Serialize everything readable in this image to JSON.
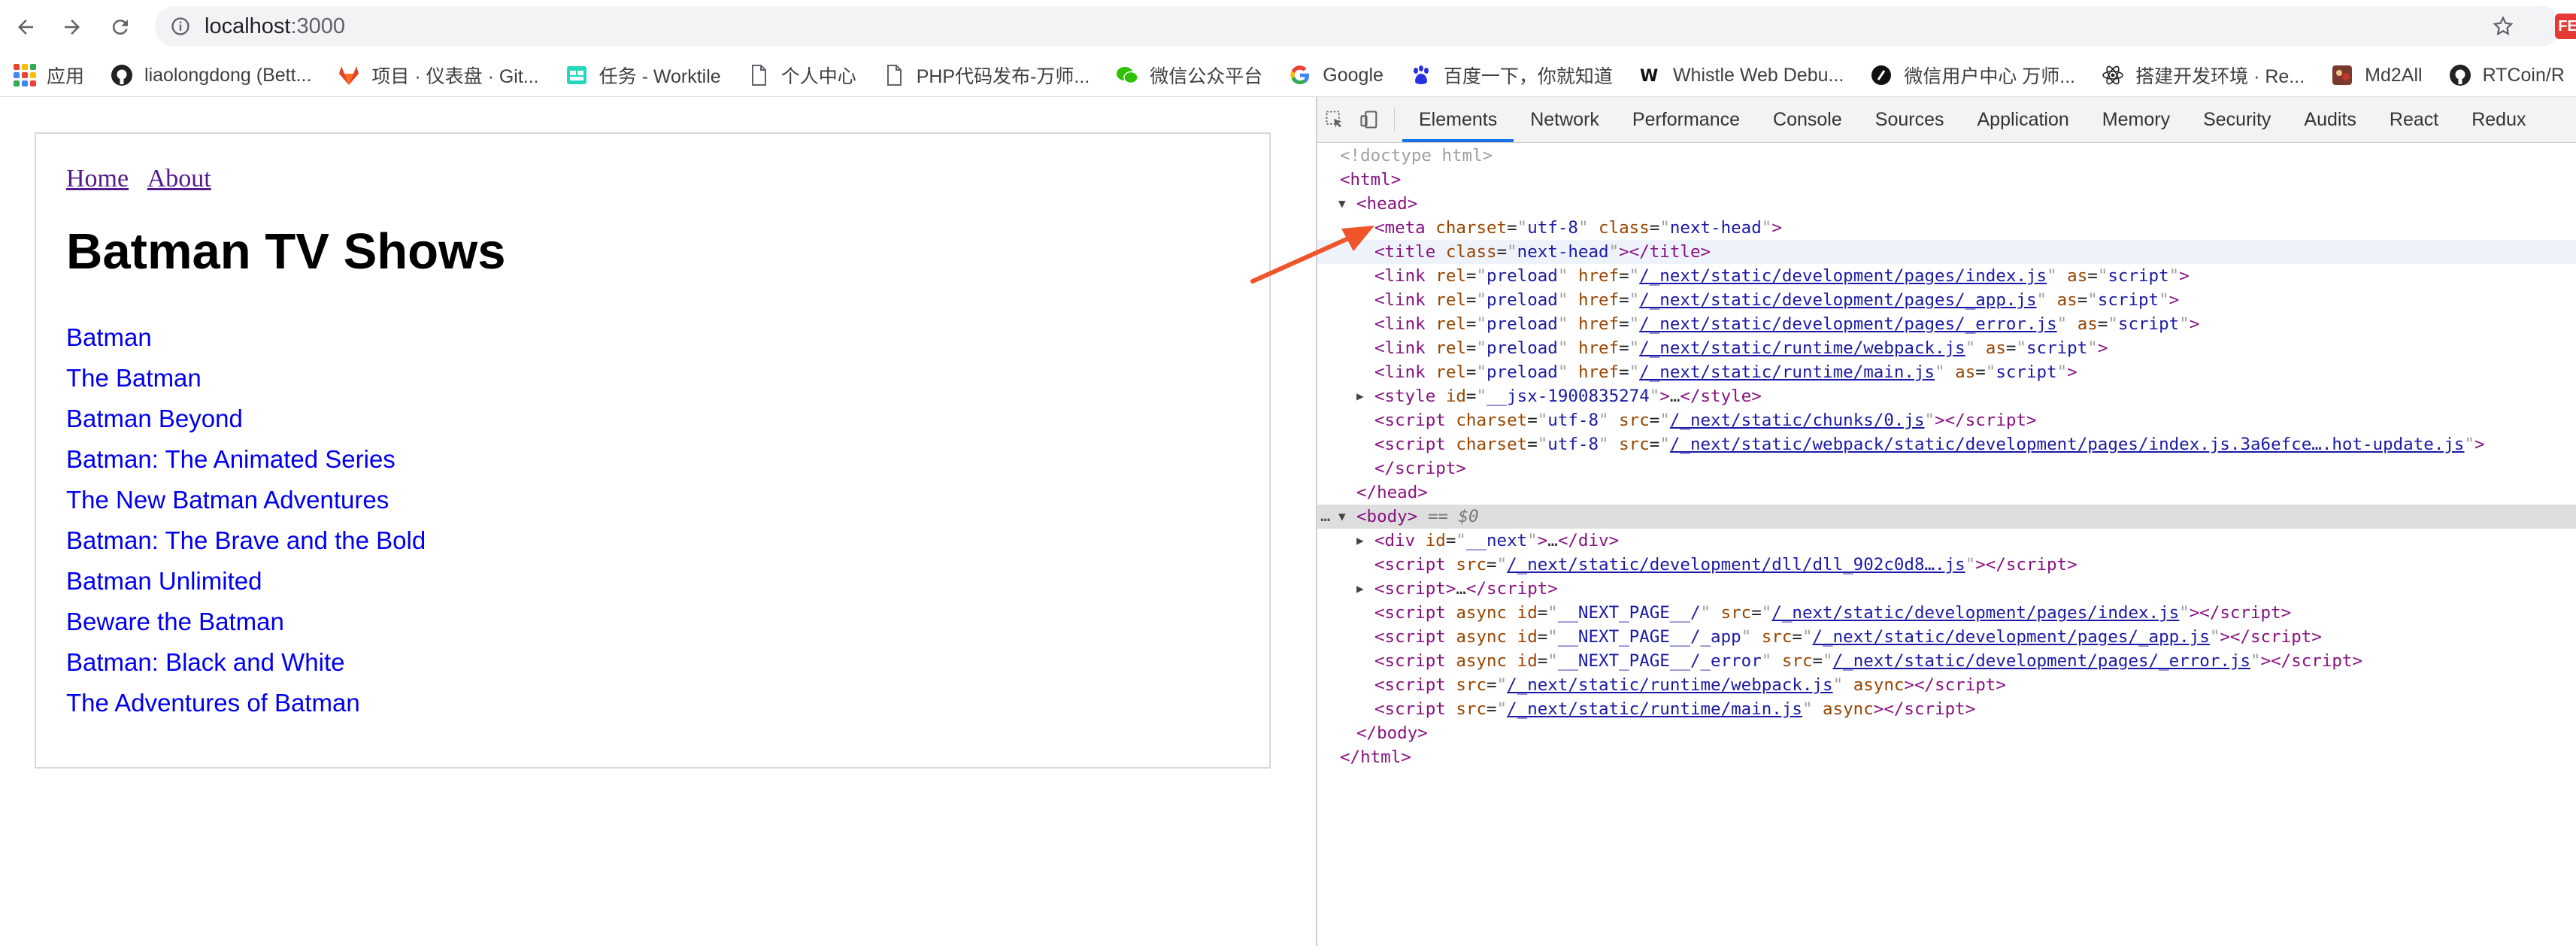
{
  "browser": {
    "url_host": "localhost",
    "url_port": ":3000",
    "extension_badge": "FE"
  },
  "bookmarks": [
    {
      "label": "应用",
      "icon": "apps-grid-icon"
    },
    {
      "label": "liaolongdong (Bett...",
      "icon": "github-icon"
    },
    {
      "label": "项目 · 仪表盘 · Git...",
      "icon": "gitlab-icon"
    },
    {
      "label": "任务 - Worktile",
      "icon": "worktile-icon"
    },
    {
      "label": "个人中心",
      "icon": "document-icon"
    },
    {
      "label": "PHP代码发布-万师...",
      "icon": "document-icon"
    },
    {
      "label": "微信公众平台",
      "icon": "wechat-icon"
    },
    {
      "label": "Google",
      "icon": "google-icon"
    },
    {
      "label": "百度一下，你就知道",
      "icon": "baidu-icon"
    },
    {
      "label": "Whistle Web Debu...",
      "icon": "whistle-icon"
    },
    {
      "label": "微信用户中心 万师...",
      "icon": "circle-logo-icon"
    },
    {
      "label": "搭建开发环境 · Re...",
      "icon": "react-icon"
    },
    {
      "label": "Md2All",
      "icon": "md2all-icon"
    },
    {
      "label": "RTCoin/R",
      "icon": "github-icon"
    }
  ],
  "page": {
    "nav": [
      "Home",
      "About"
    ],
    "title": "Batman TV Shows",
    "shows": [
      "Batman",
      "The Batman",
      "Batman Beyond",
      "Batman: The Animated Series",
      "The New Batman Adventures",
      "Batman: The Brave and the Bold",
      "Batman Unlimited",
      "Beware the Batman",
      "Batman: Black and White",
      "The Adventures of Batman"
    ]
  },
  "devtools": {
    "tabs": [
      "Elements",
      "Network",
      "Performance",
      "Console",
      "Sources",
      "Application",
      "Memory",
      "Security",
      "Audits",
      "React",
      "Redux"
    ],
    "active_tab": "Elements",
    "dom": {
      "doctype": "<!doctype html>",
      "html_open": "html",
      "head_open": "head",
      "meta": {
        "charset": "utf-8",
        "class": "next-head"
      },
      "title_class": "next-head",
      "preload_links": [
        "/_next/static/development/pages/index.js",
        "/_next/static/development/pages/_app.js",
        "/_next/static/development/pages/_error.js",
        "/_next/static/runtime/webpack.js",
        "/_next/static/runtime/main.js"
      ],
      "preload_rel": "preload",
      "preload_as": "script",
      "style_id": "__jsx-1900835274",
      "head_scripts": [
        "/_next/static/chunks/0.js",
        "/_next/static/webpack/static/development/pages/index.js.3a6efce….hot-update.js"
      ],
      "script_charset": "utf-8",
      "body_selected_suffix": "== $0",
      "div_id": "__next",
      "dll_src": "/_next/static/development/dll/dll_902c0d8….js",
      "page_scripts": [
        {
          "id": "__NEXT_PAGE__/",
          "src": "/_next/static/development/pages/index.js"
        },
        {
          "id": "__NEXT_PAGE__/_app",
          "src": "/_next/static/development/pages/_app.js"
        },
        {
          "id": "__NEXT_PAGE__/_error",
          "src": "/_next/static/development/pages/_error.js"
        }
      ],
      "runtime_scripts": [
        "/_next/static/runtime/webpack.js",
        "/_next/static/runtime/main.js"
      ]
    }
  },
  "colors": {
    "link": "#0000ee",
    "visited": "#551a8b",
    "devtools_active": "#1a73e8",
    "tag": "#881280",
    "attr": "#994500",
    "value": "#1a1aa6",
    "arrow": "#f0552a"
  }
}
